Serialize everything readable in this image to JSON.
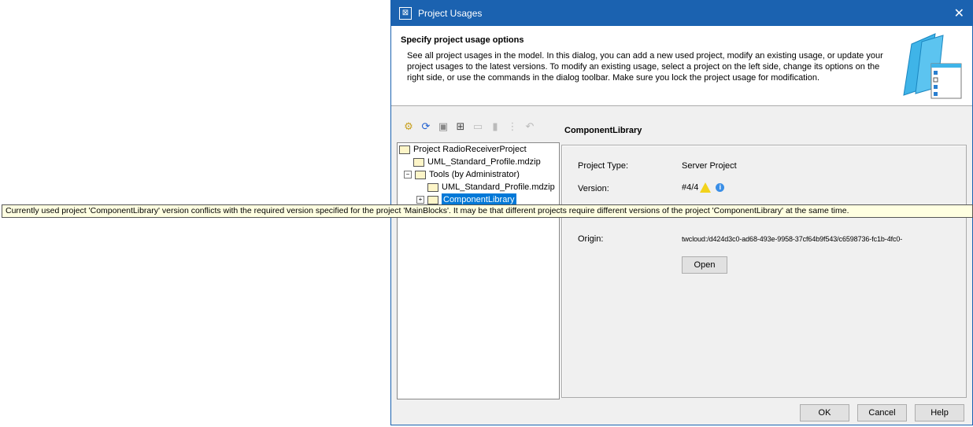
{
  "dialog": {
    "title": "Project Usages",
    "close": "✕"
  },
  "header": {
    "heading": "Specify project usage options",
    "description": "See all project usages in the model. In this dialog, you can add a new used project, modify an existing usage, or update your project usages to the latest versions. To modify an existing usage, select a project on the left side, change its options on the right side, or use the commands in the dialog toolbar. Make sure you lock the project usage for modification."
  },
  "toolbar": {
    "icons": [
      "gear-icon",
      "refresh-icon",
      "lock-icon",
      "add-usage-icon",
      "remove-usage-icon",
      "import-icon",
      "dependencies-icon",
      "undo-icon"
    ]
  },
  "tree": {
    "items": [
      "Project RadioReceiverProject",
      "UML_Standard_Profile.mdzip",
      "Tools (by Administrator)",
      "UML_Standard_Profile.mdzip",
      "ComponentLibrary"
    ]
  },
  "details": {
    "title": "ComponentLibrary",
    "project_type_label": "Project Type:",
    "project_type": "Server Project",
    "version_label": "Version:",
    "version": "#4/4",
    "origin_label": "Origin:",
    "origin": "twcloud:/d424d3c0-ad68-493e-9958-37cf64b9f543/c6598736-fc1b-4fc0-",
    "open": "Open"
  },
  "tooltip": "Currently used project 'ComponentLibrary' version conflicts with the required version specified for the project 'MainBlocks'. It may be that different projects require different versions of the project 'ComponentLibrary' at the same time.",
  "footer": {
    "ok": "OK",
    "cancel": "Cancel",
    "help": "Help"
  },
  "colors": {
    "titlebar": "#1b62b0",
    "selection": "#0078d7",
    "tooltip": "#ffffe1"
  }
}
